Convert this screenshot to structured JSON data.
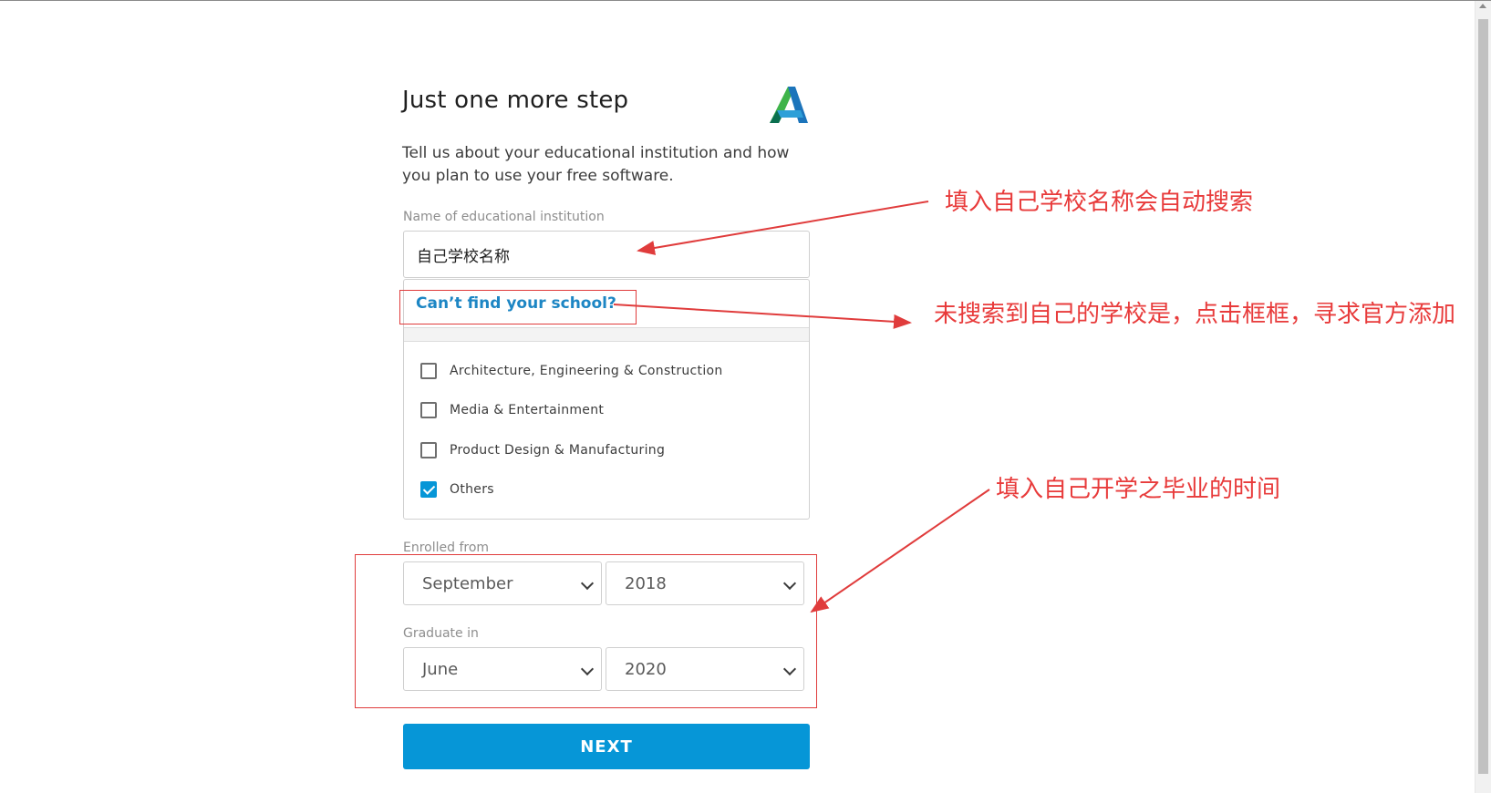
{
  "form": {
    "title": "Just one more step",
    "subtitle": "Tell us about your educational institution and how you plan to use your free software.",
    "school_label": "Name of educational institution",
    "school_value": "自己学校名称",
    "cant_find": "Can’t find your school?",
    "options": [
      {
        "label": "Architecture, Engineering & Construction",
        "checked": false
      },
      {
        "label": "Media & Entertainment",
        "checked": false
      },
      {
        "label": "Product Design & Manufacturing",
        "checked": false
      },
      {
        "label": "Others",
        "checked": true
      }
    ],
    "enrolled_label": "Enrolled from",
    "enrolled_month": "September",
    "enrolled_year": "2018",
    "graduate_label": "Graduate in",
    "graduate_month": "June",
    "graduate_year": "2020",
    "next_label": "NEXT"
  },
  "annotations": {
    "school_hint": "填入自己学校名称会自动搜索",
    "cant_find_hint": "未搜索到自己的学校是，点击框框，寻求官方添加",
    "dates_hint": "填入自己开学之毕业的时间",
    "color": "#e83b3b"
  },
  "logo": {
    "icon": "autodesk-logo",
    "colors": [
      "#0a6f4f",
      "#3fb44a",
      "#1c74bb",
      "#2d9fd8"
    ]
  },
  "accent_color": "#0696d7"
}
